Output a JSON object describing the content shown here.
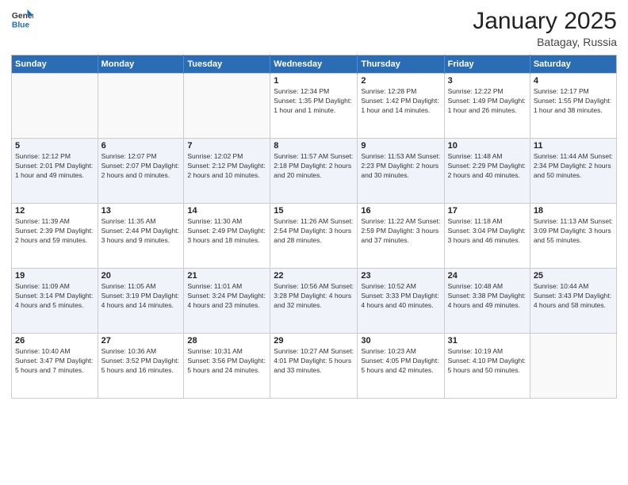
{
  "logo": {
    "general": "General",
    "blue": "Blue"
  },
  "title": "January 2025",
  "location": "Batagay, Russia",
  "days_of_week": [
    "Sunday",
    "Monday",
    "Tuesday",
    "Wednesday",
    "Thursday",
    "Friday",
    "Saturday"
  ],
  "weeks": [
    [
      {
        "day": "",
        "info": ""
      },
      {
        "day": "",
        "info": ""
      },
      {
        "day": "",
        "info": ""
      },
      {
        "day": "1",
        "info": "Sunrise: 12:34 PM\nSunset: 1:35 PM\nDaylight: 1 hour and 1 minute."
      },
      {
        "day": "2",
        "info": "Sunrise: 12:28 PM\nSunset: 1:42 PM\nDaylight: 1 hour and 14 minutes."
      },
      {
        "day": "3",
        "info": "Sunrise: 12:22 PM\nSunset: 1:49 PM\nDaylight: 1 hour and 26 minutes."
      },
      {
        "day": "4",
        "info": "Sunrise: 12:17 PM\nSunset: 1:55 PM\nDaylight: 1 hour and 38 minutes."
      }
    ],
    [
      {
        "day": "5",
        "info": "Sunrise: 12:12 PM\nSunset: 2:01 PM\nDaylight: 1 hour and 49 minutes."
      },
      {
        "day": "6",
        "info": "Sunrise: 12:07 PM\nSunset: 2:07 PM\nDaylight: 2 hours and 0 minutes."
      },
      {
        "day": "7",
        "info": "Sunrise: 12:02 PM\nSunset: 2:12 PM\nDaylight: 2 hours and 10 minutes."
      },
      {
        "day": "8",
        "info": "Sunrise: 11:57 AM\nSunset: 2:18 PM\nDaylight: 2 hours and 20 minutes."
      },
      {
        "day": "9",
        "info": "Sunrise: 11:53 AM\nSunset: 2:23 PM\nDaylight: 2 hours and 30 minutes."
      },
      {
        "day": "10",
        "info": "Sunrise: 11:48 AM\nSunset: 2:29 PM\nDaylight: 2 hours and 40 minutes."
      },
      {
        "day": "11",
        "info": "Sunrise: 11:44 AM\nSunset: 2:34 PM\nDaylight: 2 hours and 50 minutes."
      }
    ],
    [
      {
        "day": "12",
        "info": "Sunrise: 11:39 AM\nSunset: 2:39 PM\nDaylight: 2 hours and 59 minutes."
      },
      {
        "day": "13",
        "info": "Sunrise: 11:35 AM\nSunset: 2:44 PM\nDaylight: 3 hours and 9 minutes."
      },
      {
        "day": "14",
        "info": "Sunrise: 11:30 AM\nSunset: 2:49 PM\nDaylight: 3 hours and 18 minutes."
      },
      {
        "day": "15",
        "info": "Sunrise: 11:26 AM\nSunset: 2:54 PM\nDaylight: 3 hours and 28 minutes."
      },
      {
        "day": "16",
        "info": "Sunrise: 11:22 AM\nSunset: 2:59 PM\nDaylight: 3 hours and 37 minutes."
      },
      {
        "day": "17",
        "info": "Sunrise: 11:18 AM\nSunset: 3:04 PM\nDaylight: 3 hours and 46 minutes."
      },
      {
        "day": "18",
        "info": "Sunrise: 11:13 AM\nSunset: 3:09 PM\nDaylight: 3 hours and 55 minutes."
      }
    ],
    [
      {
        "day": "19",
        "info": "Sunrise: 11:09 AM\nSunset: 3:14 PM\nDaylight: 4 hours and 5 minutes."
      },
      {
        "day": "20",
        "info": "Sunrise: 11:05 AM\nSunset: 3:19 PM\nDaylight: 4 hours and 14 minutes."
      },
      {
        "day": "21",
        "info": "Sunrise: 11:01 AM\nSunset: 3:24 PM\nDaylight: 4 hours and 23 minutes."
      },
      {
        "day": "22",
        "info": "Sunrise: 10:56 AM\nSunset: 3:28 PM\nDaylight: 4 hours and 32 minutes."
      },
      {
        "day": "23",
        "info": "Sunrise: 10:52 AM\nSunset: 3:33 PM\nDaylight: 4 hours and 40 minutes."
      },
      {
        "day": "24",
        "info": "Sunrise: 10:48 AM\nSunset: 3:38 PM\nDaylight: 4 hours and 49 minutes."
      },
      {
        "day": "25",
        "info": "Sunrise: 10:44 AM\nSunset: 3:43 PM\nDaylight: 4 hours and 58 minutes."
      }
    ],
    [
      {
        "day": "26",
        "info": "Sunrise: 10:40 AM\nSunset: 3:47 PM\nDaylight: 5 hours and 7 minutes."
      },
      {
        "day": "27",
        "info": "Sunrise: 10:36 AM\nSunset: 3:52 PM\nDaylight: 5 hours and 16 minutes."
      },
      {
        "day": "28",
        "info": "Sunrise: 10:31 AM\nSunset: 3:56 PM\nDaylight: 5 hours and 24 minutes."
      },
      {
        "day": "29",
        "info": "Sunrise: 10:27 AM\nSunset: 4:01 PM\nDaylight: 5 hours and 33 minutes."
      },
      {
        "day": "30",
        "info": "Sunrise: 10:23 AM\nSunset: 4:05 PM\nDaylight: 5 hours and 42 minutes."
      },
      {
        "day": "31",
        "info": "Sunrise: 10:19 AM\nSunset: 4:10 PM\nDaylight: 5 hours and 50 minutes."
      },
      {
        "day": "",
        "info": ""
      }
    ]
  ]
}
